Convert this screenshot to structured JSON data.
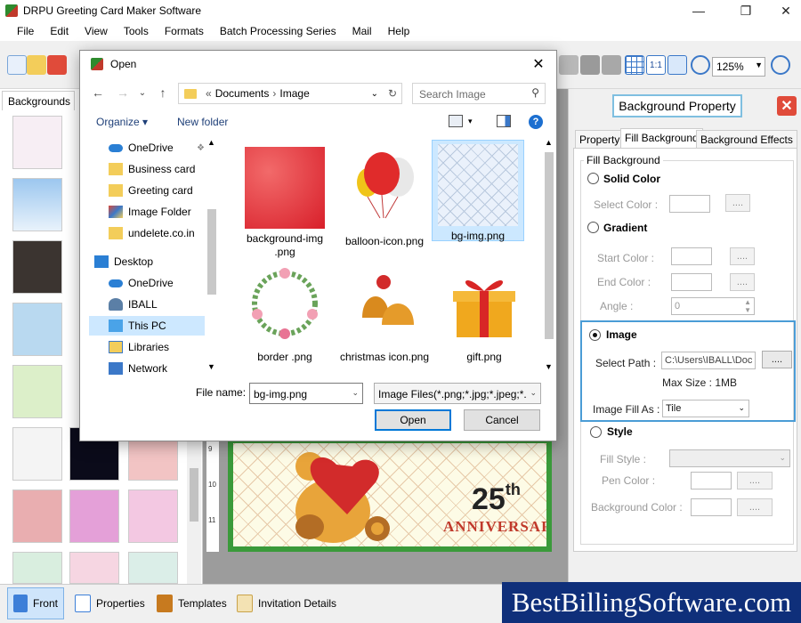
{
  "app": {
    "title": "DRPU Greeting Card Maker Software",
    "menu": [
      "File",
      "Edit",
      "View",
      "Tools",
      "Formats",
      "Batch Processing Series",
      "Mail",
      "Help"
    ],
    "zoom": "125%"
  },
  "left_panel": {
    "tab": "Backgrounds"
  },
  "canvas": {
    "ruler": [
      "9",
      "10",
      "11"
    ],
    "card": {
      "number": "25",
      "suffix": "th",
      "text": "ANNIVERSARY"
    }
  },
  "right_panel": {
    "title": "Background Property",
    "tabs": [
      "Property",
      "Fill Background",
      "Background Effects"
    ],
    "group_title": "Fill Background",
    "solid_color": {
      "label": "Solid Color",
      "select_color": "Select Color :"
    },
    "gradient": {
      "label": "Gradient",
      "start_color": "Start Color :",
      "end_color": "End Color :",
      "angle": "Angle :",
      "angle_value": "0"
    },
    "image": {
      "label": "Image",
      "select_path": "Select Path :",
      "path_value": "C:\\Users\\IBALL\\Doc",
      "max_size": "Max Size : 1MB",
      "fill_as": "Image Fill As :",
      "fill_value": "Tile"
    },
    "style": {
      "label": "Style",
      "fill_style": "Fill Style :",
      "pen_color": "Pen Color :",
      "background_color": "Background Color :"
    },
    "dots": "...."
  },
  "bottom_tabs": [
    "Front",
    "Properties",
    "Templates",
    "Invitation Details"
  ],
  "brand": "BestBillingSoftware.com",
  "dialog": {
    "title": "Open",
    "breadcrumb": [
      "Documents",
      "Image"
    ],
    "breadcrumb_prefix": "«",
    "search_placeholder": "Search Image",
    "organize": "Organize ▾",
    "new_folder": "New folder",
    "nav_items": [
      "OneDrive",
      "Business card",
      "Greeting card",
      "Image Folder",
      "undelete.co.in",
      "Desktop",
      "OneDrive",
      "IBALL",
      "This PC",
      "Libraries",
      "Network"
    ],
    "files": [
      "background-img .png",
      "balloon-icon.png",
      "bg-img.png",
      "border .png",
      "christmas icon.png",
      "gift.png"
    ],
    "file_name_label": "File name:",
    "file_name_value": "bg-img.png",
    "file_type": "Image Files(*.png;*.jpg;*.jpeg;*.",
    "open_button": "Open",
    "cancel_button": "Cancel"
  }
}
